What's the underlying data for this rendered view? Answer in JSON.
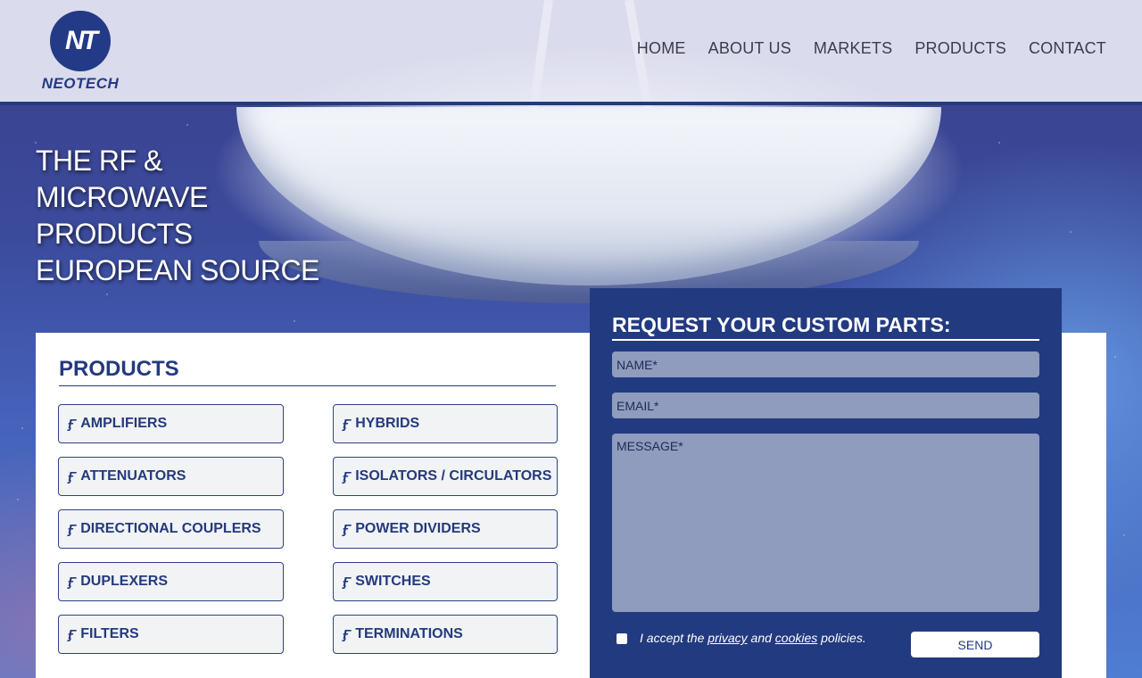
{
  "brand": {
    "logo_mark": "NT",
    "name": "NEOTECH"
  },
  "nav": [
    {
      "label": "HOME"
    },
    {
      "label": "ABOUT US"
    },
    {
      "label": "MARKETS"
    },
    {
      "label": "PRODUCTS"
    },
    {
      "label": "CONTACT"
    }
  ],
  "hero": {
    "line1": "THE RF &",
    "line2": "MICROWAVE",
    "line3": "PRODUCTS",
    "line4": "EUROPEAN SOURCE"
  },
  "products": {
    "title": "PRODUCTS",
    "icon": "rf-component-icon",
    "items": [
      "AMPLIFIERS",
      "ATTENUATORS",
      "DIRECTIONAL COUPLERS",
      "DUPLEXERS",
      "FILTERS",
      "HYBRIDS",
      "ISOLATORS / CIRCULATORS",
      "POWER DIVIDERS",
      "SWITCHES",
      "TERMINATIONS"
    ]
  },
  "form": {
    "title": "REQUEST YOUR CUSTOM PARTS:",
    "name_placeholder": "NAME*",
    "email_placeholder": "EMAIL*",
    "message_placeholder": "MESSAGE*",
    "accept_prefix": "I accept the",
    "privacy_link": "privacy",
    "accept_and": "and",
    "cookies_link": "cookies",
    "accept_suffix": "policies.",
    "send_label": "SEND"
  },
  "colors": {
    "brand_blue": "#223a7f",
    "field_bg": "#8f9cbe",
    "button_bg": "#f1f3f4"
  }
}
